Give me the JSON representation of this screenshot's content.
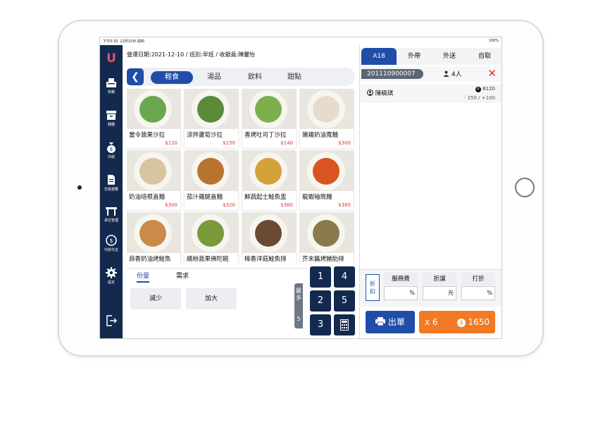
{
  "status_bar": {
    "time": "下午5:33",
    "date": "12月10日 週四",
    "battery": "100%"
  },
  "sidebar": {
    "logo": "U",
    "items": [
      {
        "label": "收銀",
        "icon": "cash-register-icon"
      },
      {
        "label": "錢櫃",
        "icon": "drawer-icon"
      },
      {
        "label": "日結",
        "icon": "money-bag-icon"
      },
      {
        "label": "交易瀏覽",
        "icon": "document-icon"
      },
      {
        "label": "桌位管理",
        "icon": "table-icon"
      },
      {
        "label": "代收代支",
        "icon": "coin-exchange-icon"
      },
      {
        "label": "設定",
        "icon": "gear-icon"
      }
    ],
    "logout_icon": "logout-icon"
  },
  "header": {
    "info": "營運日期:2021-12-10  /  班別:早班  /  收銀員:陳馨怡"
  },
  "categories": {
    "back_icon": "chevron-left-icon",
    "items": [
      "輕食",
      "湯品",
      "飲料",
      "甜點"
    ],
    "active": "輕食"
  },
  "menu": [
    {
      "name": "當令蔬果沙拉",
      "price": "$120",
      "color": "#6aa84f"
    },
    {
      "name": "涼拌蘆筍沙拉",
      "price": "$150",
      "color": "#5b8a3a"
    },
    {
      "name": "香烤吐司丁沙拉",
      "price": "$140",
      "color": "#7fae4f"
    },
    {
      "name": "嫩雞奶油寬麵",
      "price": "$300",
      "color": "#e7dccb"
    },
    {
      "name": "奶油培根直麵",
      "price": "$300",
      "color": "#d9c4a0"
    },
    {
      "name": "茄汁雞腿直麵",
      "price": "$320",
      "color": "#b8742f"
    },
    {
      "name": "鮮蔬起士鮭魚盅",
      "price": "$360",
      "color": "#d4a23a"
    },
    {
      "name": "龍蝦袖筒麵",
      "price": "$360",
      "color": "#d9541e"
    },
    {
      "name": "蒜香奶油烤鮭魚",
      "price": "",
      "color": "#c98a4a"
    },
    {
      "name": "繽紛蔬果佛陀碗",
      "price": "",
      "color": "#7a9a3a"
    },
    {
      "name": "樟香洋菇鮭魚排",
      "price": "",
      "color": "#6b4a34"
    },
    {
      "name": "芥末醬烤豬肋排",
      "price": "",
      "color": "#8a7a4a"
    }
  ],
  "options": {
    "tabs": [
      "份量",
      "需求"
    ],
    "active_tab": "份量",
    "buttons": [
      "減少",
      "加大"
    ],
    "max_label": "最多",
    "max_value": "5"
  },
  "numpad": {
    "keys": [
      "1",
      "4",
      "2",
      "5",
      "3"
    ],
    "calculator_icon": "calculator-icon"
  },
  "order": {
    "tabs": [
      "A18",
      "外帶",
      "外送",
      "自取"
    ],
    "active_tab": "A18",
    "order_no": "201110900007",
    "people": "4人",
    "member_name": "陳曉琪",
    "points": "8120",
    "points_change": "- 250 / +100"
  },
  "discount": {
    "button": "折扣",
    "fields": [
      {
        "label": "服務費",
        "unit": "%"
      },
      {
        "label": "折讓",
        "unit": "元"
      },
      {
        "label": "打折",
        "unit": "%"
      }
    ]
  },
  "actions": {
    "print_label": "出單",
    "quantity": "x 6",
    "total": "1650"
  },
  "colors": {
    "navy": "#132a4e",
    "blue": "#1f4da8",
    "orange": "#f27a24",
    "red": "#e0333a"
  }
}
